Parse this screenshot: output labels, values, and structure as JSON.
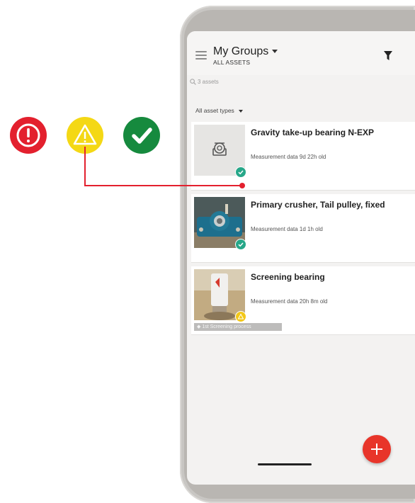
{
  "legend": [
    {
      "status": "alarm",
      "color": "#e3202e",
      "icon": "exclamation-circle-icon"
    },
    {
      "status": "warning",
      "color": "#f4d815",
      "icon": "warning-triangle-icon"
    },
    {
      "status": "ok",
      "color": "#168a3e",
      "icon": "checkmark-icon"
    }
  ],
  "header": {
    "title": "My Groups",
    "subtitle": "ALL ASSETS"
  },
  "search": {
    "count_text": "3 assets"
  },
  "filter": {
    "asset_types_label": "All asset types"
  },
  "assets": [
    {
      "name": "Gravity take-up bearing N-EXP",
      "measurement": "Measurement data 9d 22h old",
      "status": "ok",
      "tag": ""
    },
    {
      "name": "Primary crusher, Tail pulley, fixed",
      "measurement": "Measurement data 1d 1h old",
      "status": "ok",
      "tag": ""
    },
    {
      "name": "Screening bearing",
      "measurement": "Measurement data 20h 8m old",
      "status": "warning",
      "tag": "1st Screening process"
    }
  ],
  "colors": {
    "accent": "#e8352a",
    "ok": "#27a789",
    "warning": "#f3c818",
    "connector": "#e3202e"
  }
}
